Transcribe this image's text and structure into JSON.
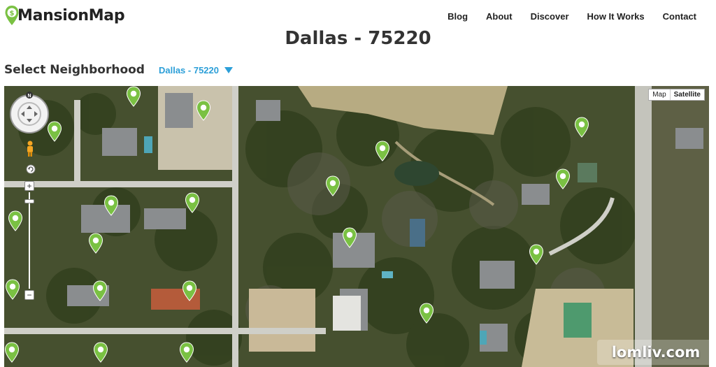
{
  "header": {
    "logo_text": "MansionMap",
    "logo_pin_symbol": "$",
    "nav": [
      {
        "label": "Blog"
      },
      {
        "label": "About"
      },
      {
        "label": "Discover"
      },
      {
        "label": "How It Works"
      },
      {
        "label": "Contact"
      }
    ]
  },
  "page": {
    "title": "Dallas - 75220"
  },
  "neighborhood": {
    "label": "Select Neighborhood",
    "selected": "Dallas - 75220"
  },
  "map": {
    "view": "aerial",
    "map_types": [
      {
        "label": "Map",
        "active": false
      },
      {
        "label": "Satellite",
        "active": true
      }
    ],
    "compass_label": "N",
    "zoom_plus": "+",
    "zoom_minus": "−",
    "marker_color": "#7ac143",
    "marker_count": 20
  },
  "watermark": {
    "text": "lomliv.com"
  },
  "colors": {
    "accent": "#2c9fd8",
    "marker": "#7ac143"
  }
}
